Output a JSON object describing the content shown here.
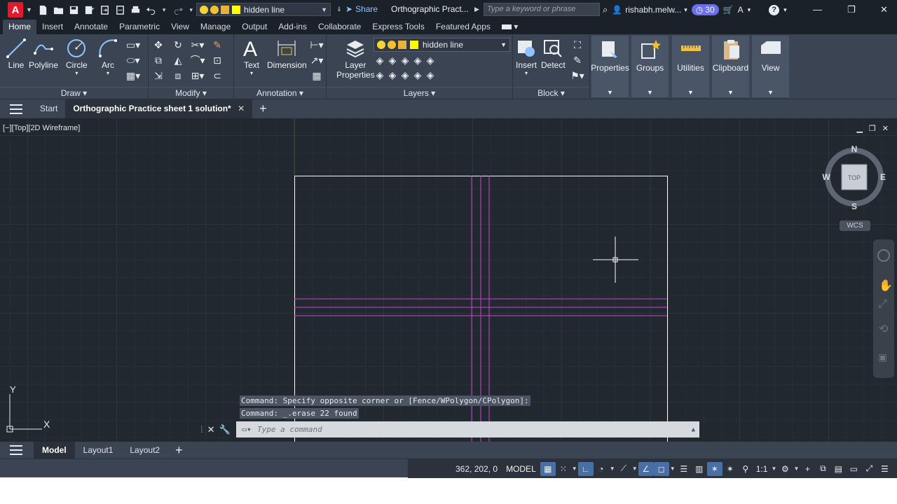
{
  "app": {
    "logo_letter": "A",
    "layer_name": "hidden line",
    "share_label": "Share",
    "doc_title": "Orthographic Pract...",
    "search_placeholder": "Type a keyword or phrase",
    "user_name": "rishabh.melw...",
    "timer_count": "30"
  },
  "ribbon_tabs": [
    "Home",
    "Insert",
    "Annotate",
    "Parametric",
    "View",
    "Manage",
    "Output",
    "Add-ins",
    "Collaborate",
    "Express Tools",
    "Featured Apps"
  ],
  "ribbon": {
    "draw": {
      "title": "Draw",
      "buttons": [
        "Line",
        "Polyline",
        "Circle",
        "Arc"
      ]
    },
    "modify": {
      "title": "Modify"
    },
    "annotation": {
      "title": "Annotation",
      "buttons": [
        "Text",
        "Dimension"
      ]
    },
    "layers": {
      "title": "Layers",
      "layer_properties_line1": "Layer",
      "layer_properties_line2": "Properties",
      "current_layer": "hidden line"
    },
    "block": {
      "title": "Block",
      "buttons": [
        "Insert",
        "Detect"
      ]
    },
    "tiles": [
      "Properties",
      "Groups",
      "Utilities",
      "Clipboard",
      "View"
    ]
  },
  "file_tabs": {
    "start": "Start",
    "active": "Orthographic Practice sheet 1 solution*"
  },
  "viewport": {
    "label": "[−][Top][2D Wireframe]",
    "viewcube": {
      "n": "N",
      "s": "S",
      "e": "E",
      "w": "W",
      "face": "TOP"
    },
    "wcs": "WCS",
    "ucs_x": "X",
    "ucs_y": "Y"
  },
  "command": {
    "history": [
      "Command: Specify opposite corner or [Fence/WPolygon/CPolygon]:",
      "Command: _.erase 22 found"
    ],
    "placeholder": "Type a command"
  },
  "layout_tabs": [
    "Model",
    "Layout1",
    "Layout2"
  ],
  "status": {
    "coords": "362, 202, 0",
    "space": "MODEL",
    "scale": "1:1"
  },
  "colors": {
    "magenta_lines": "#d43fd4",
    "outline": "#ffffff",
    "layer_color": "#ffff00",
    "accent": "#4a6fa5"
  }
}
